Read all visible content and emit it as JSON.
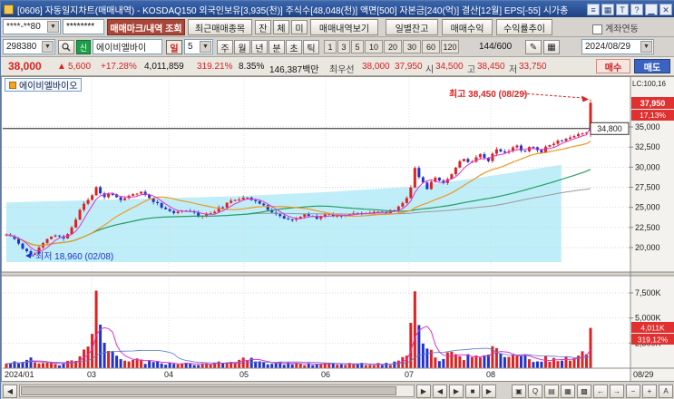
{
  "colors": {
    "up": "#dd2222",
    "down": "#2233cc",
    "ma_fast": "#dd33cc",
    "ma_mid": "#ee9922",
    "ma_slow": "#22a066",
    "ma_long": "#999999",
    "band": "#b9ecf7",
    "marker_bg": "#e03030"
  },
  "ui": {
    "chevron": "▼"
  },
  "titlebar": {
    "title": "[0606] 자동일지차트(매매내역) - KOSDAQ150 외국인보유[3,935(천)] 주식수[48,048(천)] 액면[500] 자본금[240(억)] 결산[12월] EPS[-55] 시가총",
    "icons": [
      {
        "name": "menu-icon",
        "glyph": "≡"
      },
      {
        "name": "grid-icon",
        "glyph": "▦"
      },
      {
        "name": "ticker-icon",
        "glyph": "T"
      },
      {
        "name": "help-icon",
        "glyph": "?"
      },
      {
        "name": "minimize-icon",
        "glyph": "▁"
      },
      {
        "name": "close-icon",
        "glyph": "✕"
      }
    ]
  },
  "accountbar": {
    "account": "****-**80",
    "password": "********",
    "query_button": "매매마크/내역 조회",
    "recent_button": "최근매매종목",
    "filter_jan": "잔",
    "filter_che": "체",
    "filter_mi": "미",
    "history_button": "매매내역보기",
    "daily_balance_button": "일별잔고",
    "trade_profit_button": "매매수익",
    "profit_trend_button": "수익률추이",
    "account_link_label": "계좌연동"
  },
  "stockbar": {
    "code": "298380",
    "badge": "신",
    "name": "에이비엘바이",
    "period_day": "일",
    "period_value": "5",
    "periods": [
      "주",
      "월",
      "년",
      "분",
      "초",
      "틱"
    ],
    "minutes": [
      "1",
      "3",
      "5",
      "10",
      "20",
      "30",
      "60",
      "120"
    ],
    "bar_count": "144/600",
    "tool_icons": [
      {
        "name": "edit-icon",
        "glyph": "✎"
      },
      {
        "name": "chart-settings-icon",
        "glyph": "▦"
      }
    ],
    "date": "2024/08/29"
  },
  "pricebar": {
    "price": "38,000",
    "arrow": "▲",
    "change": "5,600",
    "change_pct": "+17.28%",
    "volume": "4,011,859",
    "volume_pct": "319.21%",
    "turnover": "8.35%",
    "value": "146,387백만",
    "best_label": "최우선",
    "best_ask": "38,000",
    "best_bid": "37,950",
    "open_label": "시",
    "open": "34,500",
    "high_label": "고",
    "high": "38,450",
    "low_label": "저",
    "low": "33,750",
    "buy_button": "매수",
    "sell_button": "매도"
  },
  "chart": {
    "tab": "에이비엘바이오",
    "lc": "LC:100,16",
    "cur_price": "37,950",
    "cur_pct": "17,13%",
    "avg_label": "34,800",
    "high_note": "최고 38,450 (08/29)",
    "low_note": "최저 18,960 (02/08)",
    "y_labels": [
      "35,000",
      "32,500",
      "30,000",
      "27,500",
      "25,000",
      "22,500",
      "20,000"
    ],
    "vol_labels": [
      "7,500K",
      "5,000K",
      "2,500K"
    ],
    "vol_cur": "4,011K",
    "vol_pct": "319,12%",
    "x_labels": [
      "2024/01",
      "03",
      "04",
      "05",
      "06",
      "07",
      "08"
    ],
    "x_last": "08/29"
  },
  "chart_data": {
    "type": "candlestick",
    "candle_count": 144,
    "price_axis": [
      20000,
      22500,
      25000,
      27500,
      30000,
      32500,
      35000
    ],
    "volume_axis_k": [
      2500,
      5000,
      7500
    ],
    "avg_price_line": 34800,
    "band_bottom": 18200,
    "band_end": 0.95,
    "band_top_anchors": [
      [
        0.0,
        25600
      ],
      [
        0.2,
        26000
      ],
      [
        0.4,
        26400
      ],
      [
        0.55,
        26900
      ],
      [
        0.7,
        27600
      ],
      [
        0.8,
        28600
      ],
      [
        0.95,
        30300
      ]
    ],
    "price_anchors": [
      [
        0.0,
        21600
      ],
      [
        0.015,
        21000
      ],
      [
        0.03,
        19800
      ],
      [
        0.045,
        18960
      ],
      [
        0.06,
        20300
      ],
      [
        0.08,
        21600
      ],
      [
        0.1,
        21100
      ],
      [
        0.115,
        22900
      ],
      [
        0.13,
        25300
      ],
      [
        0.145,
        26300
      ],
      [
        0.154,
        27600
      ],
      [
        0.165,
        26100
      ],
      [
        0.18,
        26900
      ],
      [
        0.195,
        25700
      ],
      [
        0.21,
        26400
      ],
      [
        0.23,
        26900
      ],
      [
        0.25,
        25900
      ],
      [
        0.27,
        24900
      ],
      [
        0.29,
        24200
      ],
      [
        0.31,
        24800
      ],
      [
        0.33,
        23900
      ],
      [
        0.35,
        24300
      ],
      [
        0.37,
        25100
      ],
      [
        0.39,
        25900
      ],
      [
        0.41,
        26400
      ],
      [
        0.43,
        25600
      ],
      [
        0.45,
        24700
      ],
      [
        0.47,
        23800
      ],
      [
        0.49,
        23300
      ],
      [
        0.51,
        24100
      ],
      [
        0.53,
        23700
      ],
      [
        0.55,
        24200
      ],
      [
        0.57,
        23900
      ],
      [
        0.59,
        24400
      ],
      [
        0.61,
        24100
      ],
      [
        0.63,
        24600
      ],
      [
        0.65,
        24300
      ],
      [
        0.67,
        24900
      ],
      [
        0.69,
        26600
      ],
      [
        0.699,
        30100
      ],
      [
        0.71,
        28200
      ],
      [
        0.72,
        27400
      ],
      [
        0.735,
        28800
      ],
      [
        0.75,
        28000
      ],
      [
        0.765,
        29500
      ],
      [
        0.78,
        31300
      ],
      [
        0.795,
        30400
      ],
      [
        0.81,
        31800
      ],
      [
        0.825,
        30900
      ],
      [
        0.84,
        32400
      ],
      [
        0.855,
        31600
      ],
      [
        0.87,
        32800
      ],
      [
        0.885,
        31900
      ],
      [
        0.9,
        32600
      ],
      [
        0.915,
        31900
      ],
      [
        0.93,
        32900
      ],
      [
        0.95,
        33400
      ],
      [
        0.97,
        33800
      ],
      [
        0.985,
        34200
      ],
      [
        0.993,
        34400
      ],
      [
        1.0,
        38000
      ]
    ],
    "volume_anchors_k": [
      [
        0.0,
        420
      ],
      [
        0.03,
        700
      ],
      [
        0.045,
        950
      ],
      [
        0.06,
        500
      ],
      [
        0.09,
        380
      ],
      [
        0.115,
        800
      ],
      [
        0.13,
        1500
      ],
      [
        0.146,
        2600
      ],
      [
        0.1538,
        8300
      ],
      [
        0.16,
        4900
      ],
      [
        0.168,
        2300
      ],
      [
        0.18,
        1300
      ],
      [
        0.2,
        900
      ],
      [
        0.23,
        700
      ],
      [
        0.26,
        520
      ],
      [
        0.3,
        450
      ],
      [
        0.34,
        420
      ],
      [
        0.38,
        600
      ],
      [
        0.41,
        900
      ],
      [
        0.44,
        620
      ],
      [
        0.47,
        460
      ],
      [
        0.5,
        400
      ],
      [
        0.53,
        380
      ],
      [
        0.56,
        430
      ],
      [
        0.6,
        390
      ],
      [
        0.63,
        430
      ],
      [
        0.66,
        420
      ],
      [
        0.685,
        1200
      ],
      [
        0.6993,
        7500
      ],
      [
        0.706,
        4600
      ],
      [
        0.713,
        2600
      ],
      [
        0.725,
        1500
      ],
      [
        0.74,
        1000
      ],
      [
        0.755,
        1200
      ],
      [
        0.77,
        1700
      ],
      [
        0.785,
        1100
      ],
      [
        0.8,
        950
      ],
      [
        0.815,
        1350
      ],
      [
        0.83,
        2300
      ],
      [
        0.845,
        1500
      ],
      [
        0.86,
        1150
      ],
      [
        0.875,
        1750
      ],
      [
        0.89,
        1000
      ],
      [
        0.905,
        820
      ],
      [
        0.92,
        1050
      ],
      [
        0.94,
        820
      ],
      [
        0.96,
        950
      ],
      [
        0.98,
        1150
      ],
      [
        0.993,
        1400
      ],
      [
        1.0,
        4011
      ]
    ],
    "last_candle": {
      "open": 34500,
      "high": 38450,
      "low": 33750,
      "close": 38000,
      "volume_k": 4011
    },
    "high_point": {
      "price": 38450,
      "date": "08/29"
    },
    "low_point": {
      "price": 18960,
      "date": "02/08"
    }
  },
  "bottombar": {
    "scroll_left": "◀",
    "scroll_right": "▶",
    "nav": [
      {
        "name": "nav-left-icon",
        "glyph": "◀"
      },
      {
        "name": "nav-right-icon",
        "glyph": "▶"
      },
      {
        "name": "nav-stop-icon",
        "glyph": "■"
      },
      {
        "name": "nav-play-icon",
        "glyph": "▶"
      }
    ],
    "tools": [
      {
        "name": "chart-style-icon",
        "glyph": "▣"
      },
      {
        "name": "zoom-search-icon",
        "glyph": "Q"
      },
      {
        "name": "list-icon",
        "glyph": "▤"
      },
      {
        "name": "grid-view-icon",
        "glyph": "▦"
      },
      {
        "name": "pattern-icon",
        "glyph": "▩"
      }
    ],
    "controls": [
      {
        "name": "pan-left-icon",
        "glyph": "←"
      },
      {
        "name": "pan-right-icon",
        "glyph": "→"
      },
      {
        "name": "zoom-out-icon",
        "glyph": "−"
      },
      {
        "name": "zoom-in-icon",
        "glyph": "+"
      },
      {
        "name": "auto-scale-icon",
        "glyph": "A"
      }
    ]
  }
}
